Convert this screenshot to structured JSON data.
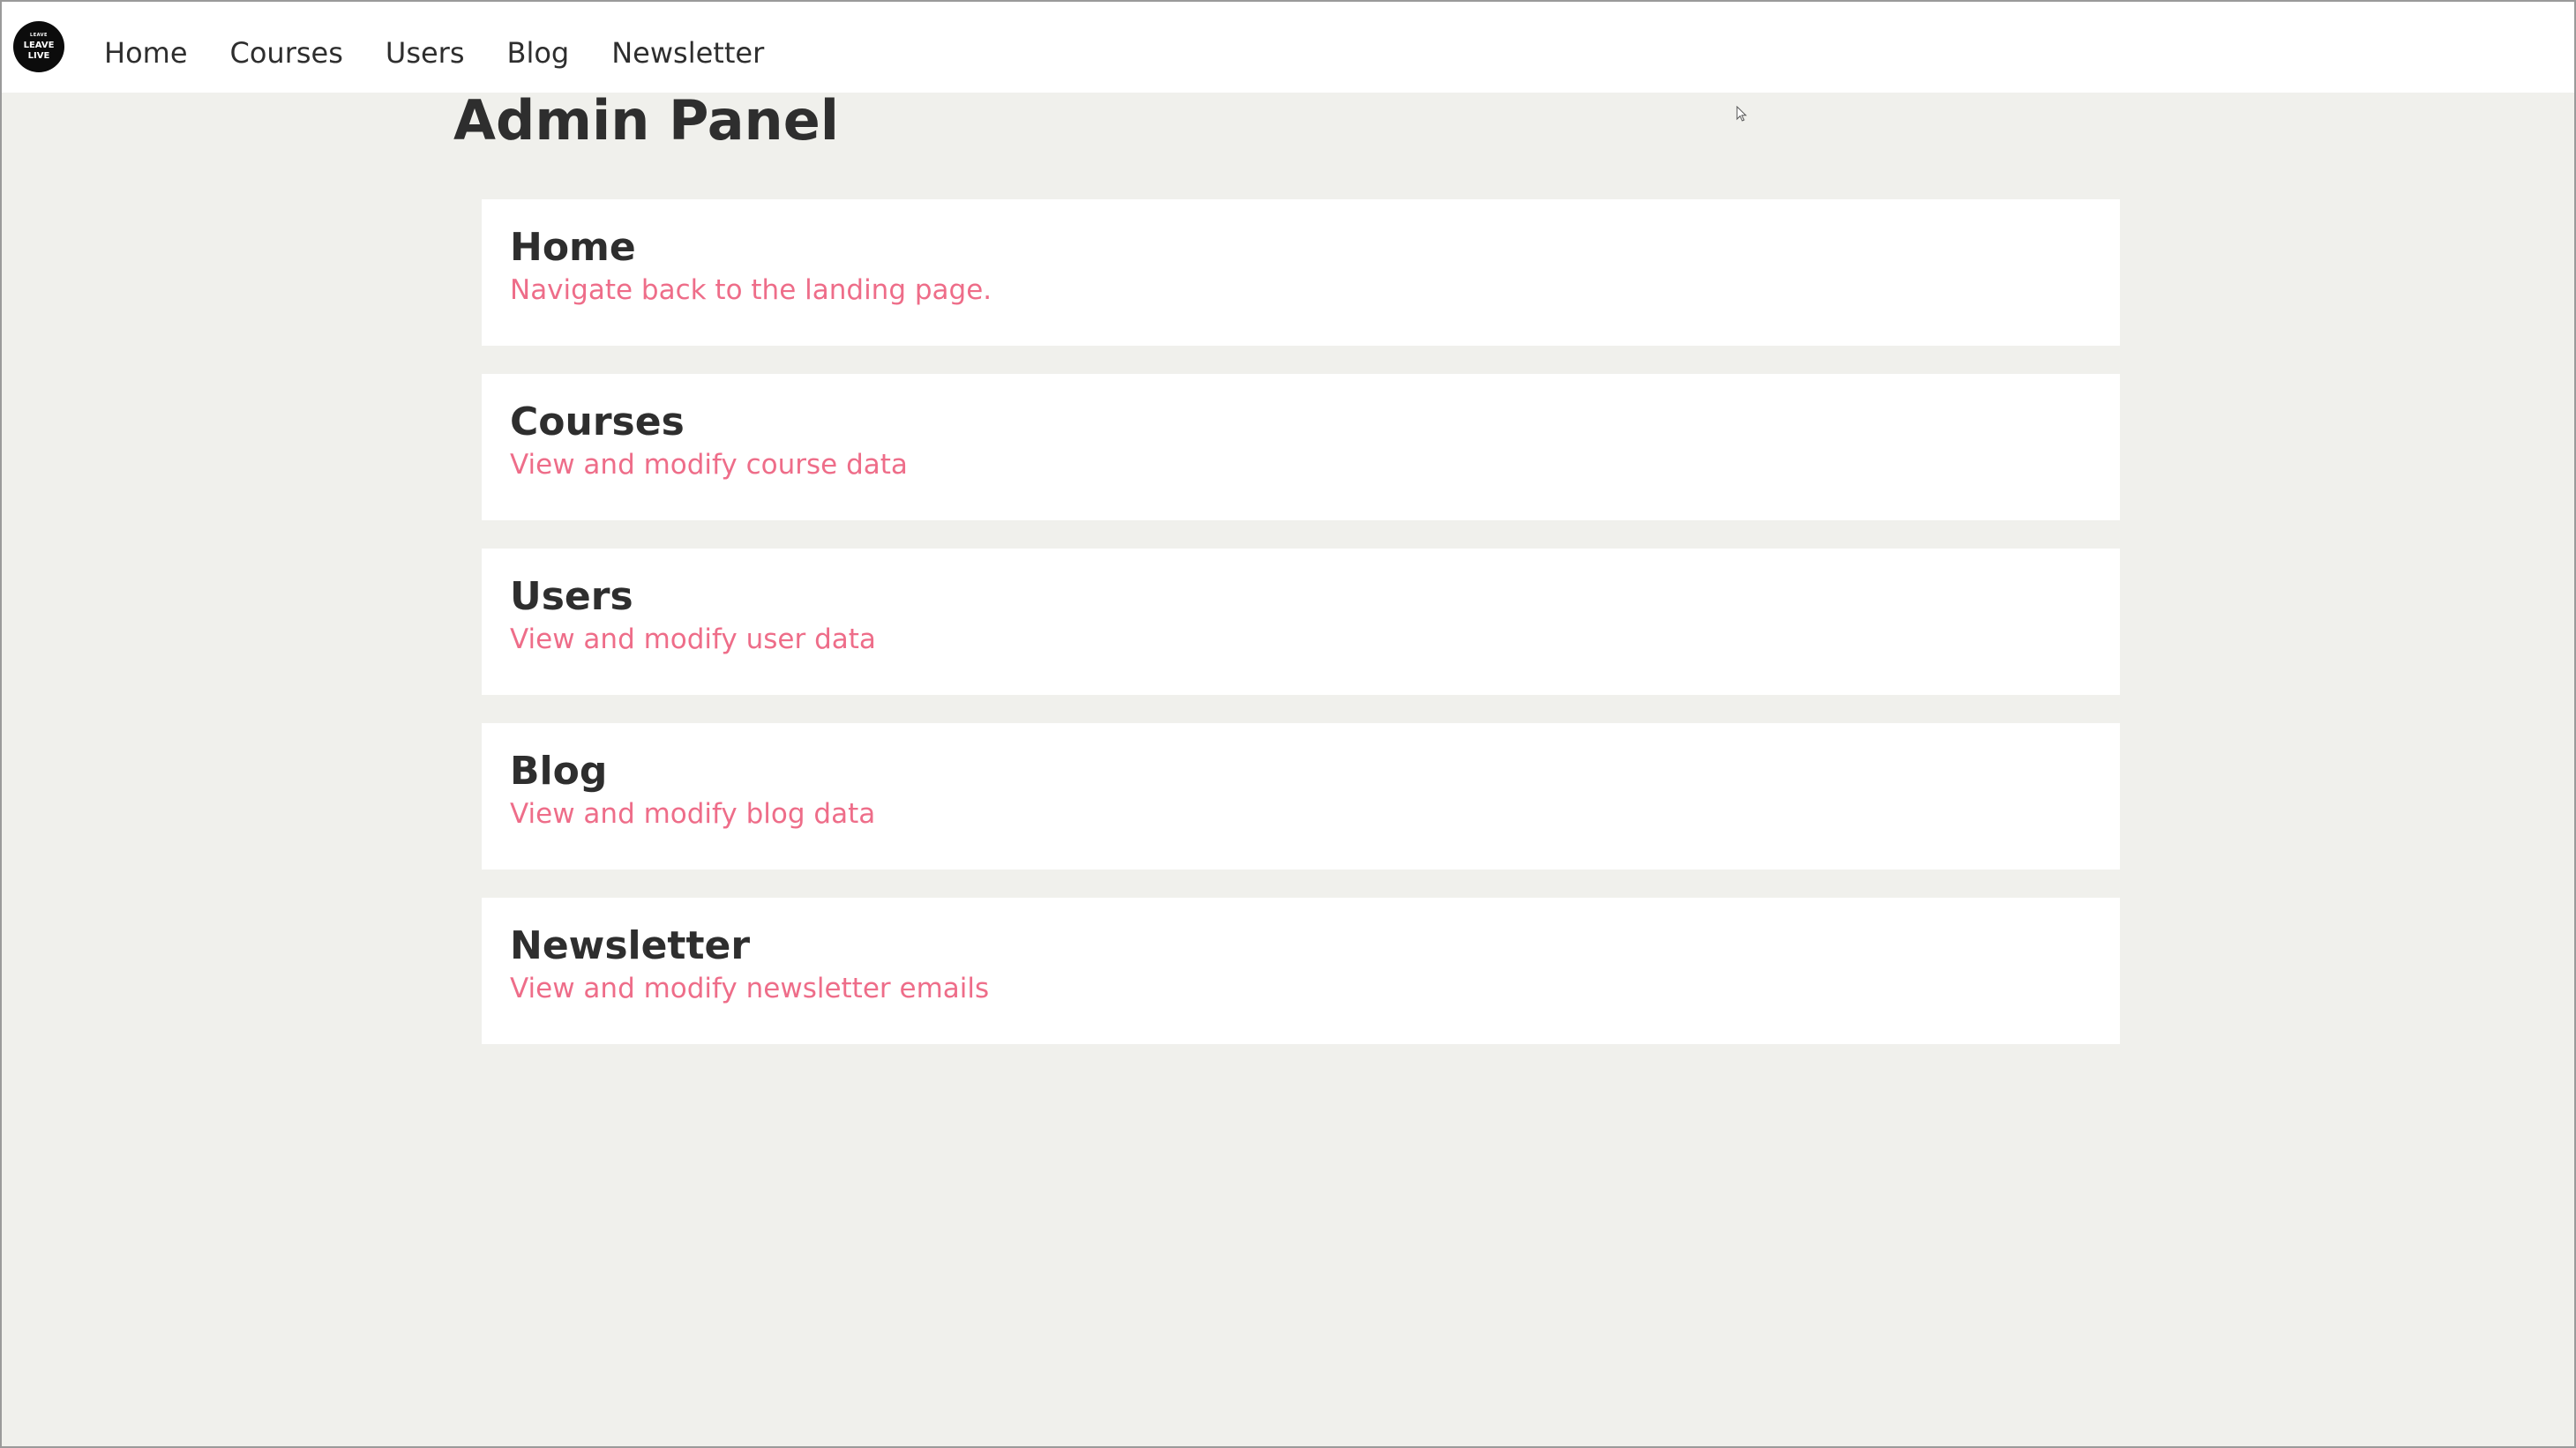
{
  "logo": {
    "small_text": "LEAVE",
    "line1": "LEAVE",
    "line2": "LIVE"
  },
  "nav": {
    "items": [
      {
        "label": "Home"
      },
      {
        "label": "Courses"
      },
      {
        "label": "Users"
      },
      {
        "label": "Blog"
      },
      {
        "label": "Newsletter"
      }
    ]
  },
  "page": {
    "title": "Admin Panel"
  },
  "cards": [
    {
      "title": "Home",
      "description": "Navigate back to the landing page."
    },
    {
      "title": "Courses",
      "description": "View and modify course data"
    },
    {
      "title": "Users",
      "description": "View and modify user data"
    },
    {
      "title": "Blog",
      "description": "View and modify blog data"
    },
    {
      "title": "Newsletter",
      "description": "View and modify newsletter emails"
    }
  ],
  "colors": {
    "accent": "#ee6d89",
    "background": "#f0f0ec",
    "card": "#ffffff",
    "text": "#2e2e2e"
  }
}
